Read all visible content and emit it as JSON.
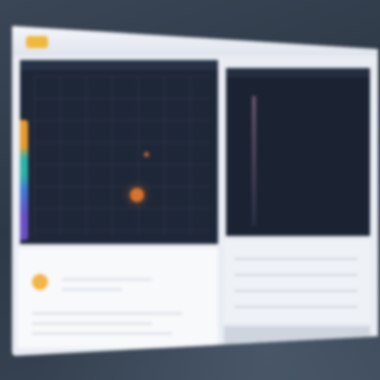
{
  "colors": {
    "accent_orange": "#e89a2c",
    "accent_teal": "#2bb3a8",
    "accent_blue": "#3f7ad6",
    "accent_purple": "#6a4fc7",
    "status_yellow": "#f4b446",
    "data_point": "#d9732c",
    "dark_pane": "#1e2738",
    "light_card": "#f8f9fb"
  },
  "icons": {
    "app_logo": "app-logo-icon",
    "status_indicator": "status-dot-icon"
  }
}
